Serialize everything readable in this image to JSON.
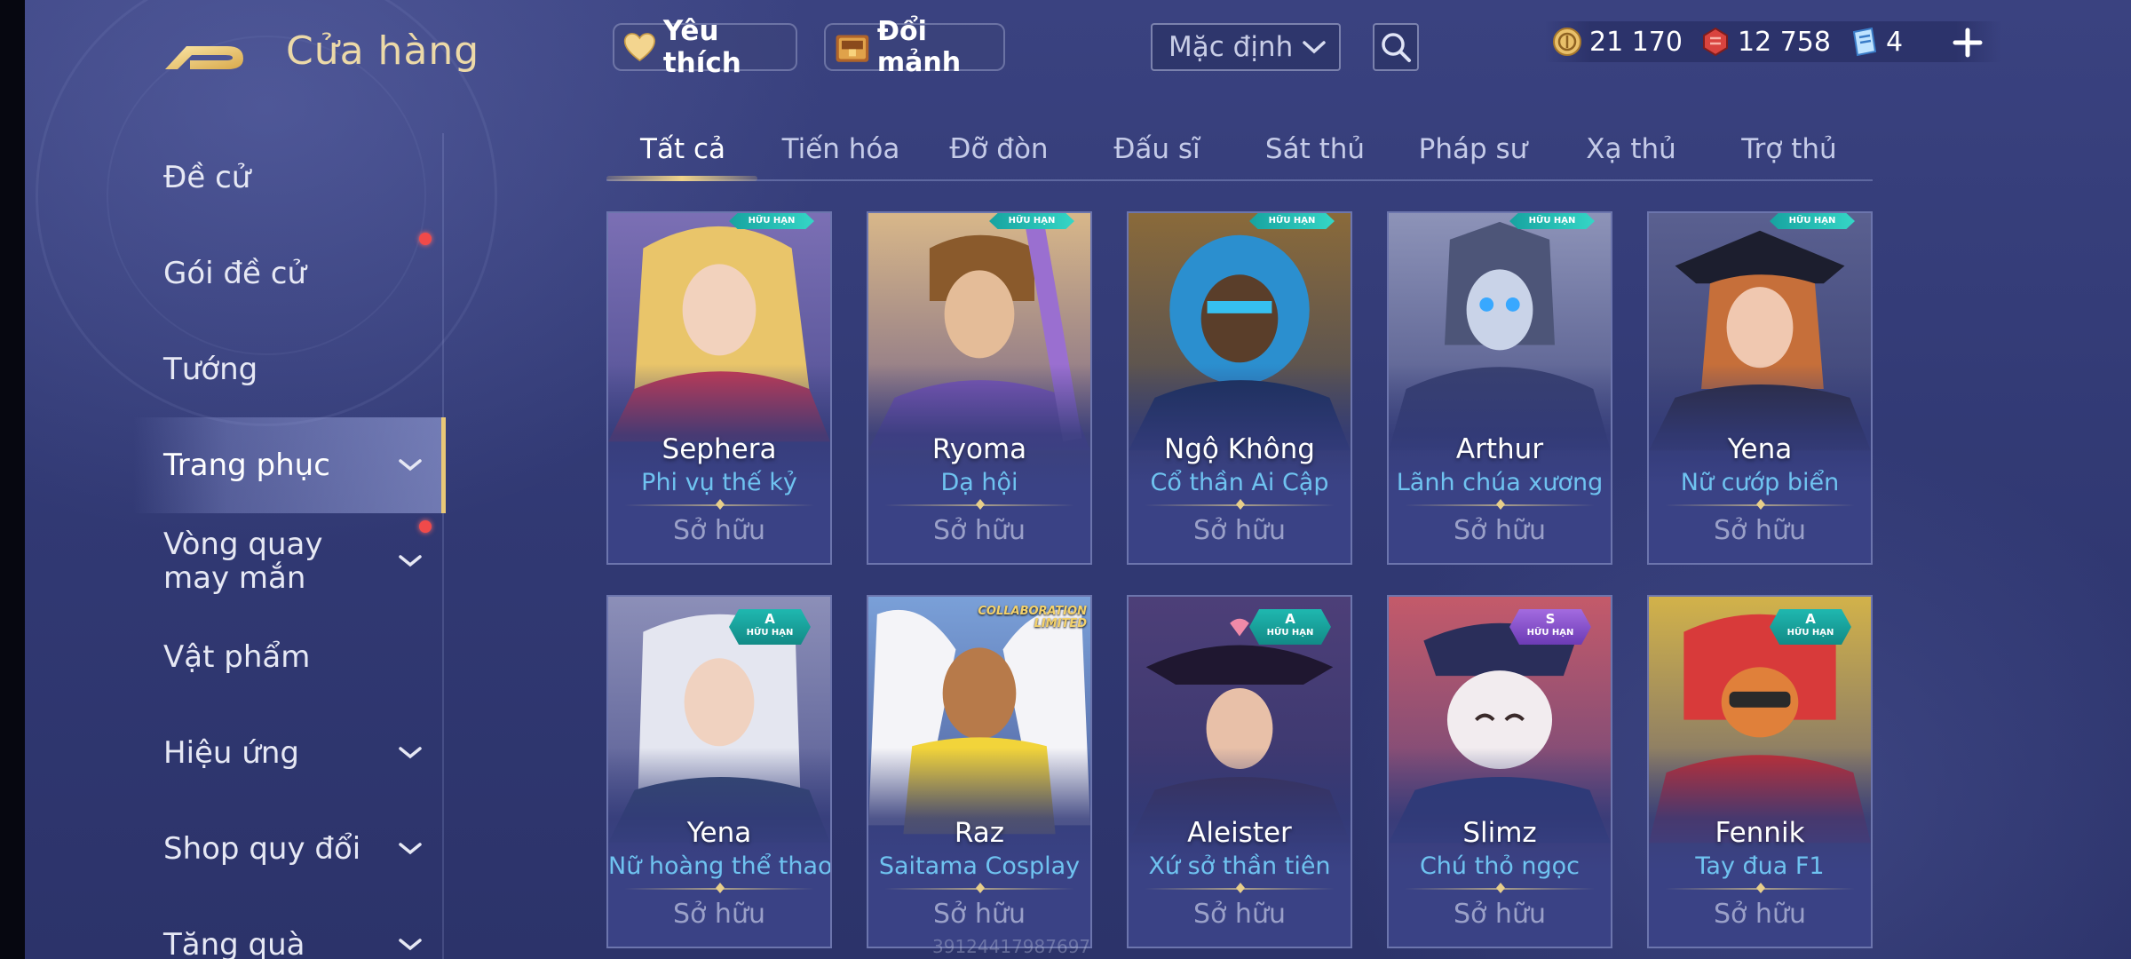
{
  "header": {
    "title": "Cửa hàng",
    "favorites_label": "Yêu thích",
    "fragments_label": "Đổi mảnh",
    "sort_value": "Mặc định",
    "currencies": [
      {
        "icon": "gold-coin-icon",
        "value": "21 170"
      },
      {
        "icon": "red-voucher-icon",
        "value": "12 758"
      },
      {
        "icon": "blue-ticket-icon",
        "value": "4"
      }
    ]
  },
  "sidebar": {
    "items": [
      {
        "label": "Đề cử"
      },
      {
        "label": "Gói đề cử"
      },
      {
        "label": "Tướng"
      },
      {
        "label": "Trang phục"
      },
      {
        "label": "Vòng quay may mắn"
      },
      {
        "label": "Vật phẩm"
      },
      {
        "label": "Hiệu ứng"
      },
      {
        "label": "Shop quy đổi"
      },
      {
        "label": "Tăng quà"
      }
    ]
  },
  "tabs": [
    "Tất cả",
    "Tiến hóa",
    "Đỡ đòn",
    "Đấu sĩ",
    "Sát thủ",
    "Pháp sư",
    "Xạ thủ",
    "Trợ thủ"
  ],
  "cards": [
    {
      "hero": "Sephera",
      "skin": "Phi vụ thế kỷ",
      "status": "Sở hữu",
      "badge": "HỮU HẠN"
    },
    {
      "hero": "Ryoma",
      "skin": "Dạ hội",
      "status": "Sở hữu",
      "badge": "HỮU HẠN"
    },
    {
      "hero": "Ngộ Không",
      "skin": "Cổ thần Ai Cập",
      "status": "Sở hữu",
      "badge": "HỮU HẠN"
    },
    {
      "hero": "Arthur",
      "skin": "Lãnh chúa xương",
      "status": "Sở hữu",
      "badge": "HỮU HẠN"
    },
    {
      "hero": "Yena",
      "skin": "Nữ cướp biển",
      "status": "Sở hữu",
      "badge": "HỮU HẠN"
    },
    {
      "hero": "Yena",
      "skin": "Nữ hoàng thể thao",
      "status": "Sở hữu",
      "grade": "A",
      "badge": "HỮU HẠN"
    },
    {
      "hero": "Raz",
      "skin": "Saitama Cosplay",
      "status": "Sở hữu",
      "collab_line1": "COLLABORATION",
      "collab_line2": "LIMITED"
    },
    {
      "hero": "Aleister",
      "skin": "Xứ sở thần tiên",
      "status": "Sở hữu",
      "grade": "A",
      "badge": "HỮU HẠN"
    },
    {
      "hero": "Slimz",
      "skin": "Chú thỏ ngọc",
      "status": "Sở hữu",
      "grade": "S",
      "badge": "HỮU HẠN"
    },
    {
      "hero": "Fennik",
      "skin": "Tay đua F1",
      "status": "Sở hữu",
      "grade": "A",
      "badge": "HỮU HẠN"
    }
  ],
  "watermark": "39124417987697",
  "colors": {
    "accent_gold": "#e9c877",
    "skin_name_blue": "#6fc3f0",
    "badge_teal": "#1fb8b0",
    "badge_purple": "#a36be0",
    "notification_red": "#f04a4a"
  }
}
